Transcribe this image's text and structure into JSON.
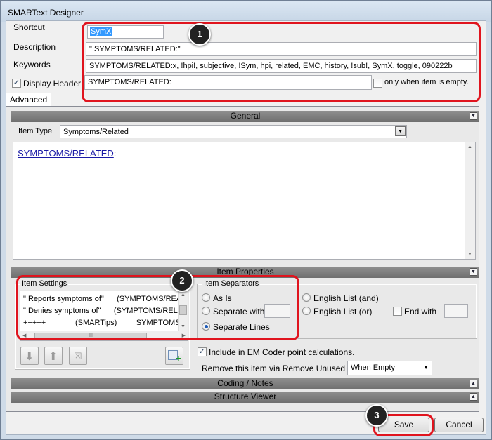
{
  "window": {
    "title": "SMARText Designer"
  },
  "header": {
    "shortcut_label": "Shortcut",
    "shortcut_value": "SymX",
    "description_label": "Description",
    "description_value": "\"  SYMPTOMS/RELATED:\"",
    "keywords_label": "Keywords",
    "keywords_value": "SYMPTOMS/RELATED:x, !hpi!, subjective, !Sym, hpi, related, EMC, history, !sub!, SymX, toggle, 090222b",
    "display_header_label": "Display Header",
    "display_header_checked": true,
    "display_header_value": "SYMPTOMS/RELATED:",
    "only_when_empty_label": "only when item is empty.",
    "only_when_empty_checked": false
  },
  "tabs": [
    {
      "label": "Advanced"
    }
  ],
  "general": {
    "section_title": "General",
    "item_type_label": "Item Type",
    "item_type_value": "Symptoms/Related",
    "editor_link": "SYMPTOMS/RELATED",
    "editor_suffix": ":"
  },
  "item_properties": {
    "section_title": "Item Properties",
    "item_settings_title": "Item Settings",
    "item_settings_rows": [
      {
        "col1": "\" Reports symptoms of\"",
        "col2": "(SYMPTOMS/REA"
      },
      {
        "col1": "\" Denies symptoms of\"",
        "col2": "(SYMPTOMS/RELA"
      },
      {
        "col1": "+++++",
        "col2": "(SMARTips)         SYMPTOMS/REL"
      }
    ],
    "hscroll_grip": "III",
    "separators_title": "Item Separators",
    "sep_as_is": "As Is",
    "sep_separate_with": "Separate with",
    "sep_separate_lines": "Separate Lines",
    "sep_english_and": "English List (and)",
    "sep_english_or": "English List (or)",
    "end_with_label": "End with",
    "include_em_label": "Include in EM Coder point calculations.",
    "include_em_checked": true,
    "remove_unused_label": "Remove this item via Remove Unused -",
    "remove_unused_value": "When Empty"
  },
  "sections": {
    "coding_notes": "Coding / Notes",
    "structure_viewer": "Structure Viewer"
  },
  "buttons": {
    "save": "Save",
    "cancel": "Cancel"
  },
  "callouts": {
    "one": "1",
    "two": "2",
    "three": "3"
  },
  "colors": {
    "callout_red": "#e0141e",
    "link_blue": "#1a1aa6"
  }
}
